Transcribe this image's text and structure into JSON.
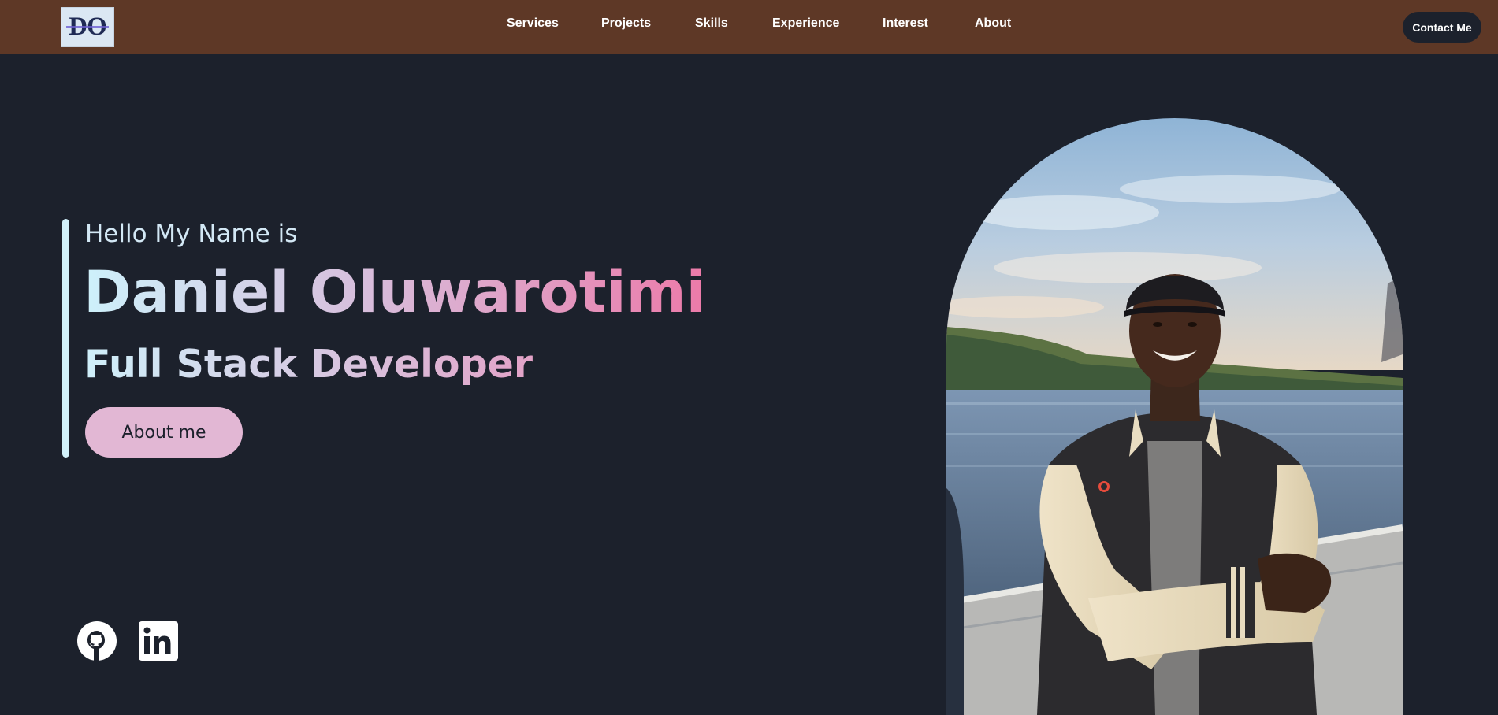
{
  "logo": {
    "text": "DO",
    "icon": "do-logo-icon"
  },
  "nav": {
    "links": [
      "Services",
      "Projects",
      "Skills",
      "Experience",
      "Interest",
      "About"
    ],
    "contact_label": "Contact Me"
  },
  "hero": {
    "greeting": "Hello My Name is",
    "name": "Daniel Oluwarotimi",
    "role": "Full Stack Developer",
    "about_label": "About me"
  },
  "social": [
    {
      "name": "github-icon",
      "label": "GitHub"
    },
    {
      "name": "linkedin-icon",
      "label": "LinkedIn"
    }
  ],
  "photo": {
    "alt": "portrait-photo"
  },
  "colors": {
    "navbar": "#5e3826",
    "background": "#1c212c",
    "accent_pink": "#e2b7d4",
    "accent_cyan": "#d1f1fb",
    "name_end": "#ec7aa9"
  }
}
